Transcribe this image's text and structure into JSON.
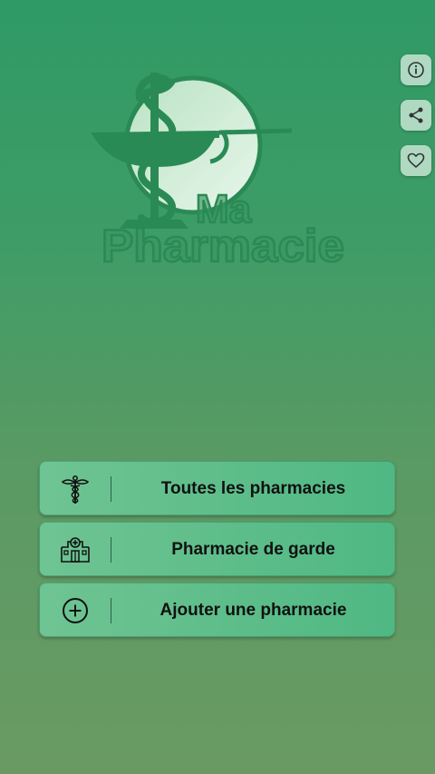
{
  "app": {
    "logo_line1": "Ma",
    "logo_line2": "Pharmacie",
    "logo_icon": "caduceus-bowl-icon"
  },
  "colors": {
    "bg_top": "#2f9a66",
    "bg_bottom": "#6a9a63",
    "button_fill": "#5cbd88",
    "logo_green": "#2a8a55",
    "text": "#111111"
  },
  "side_actions": [
    {
      "icon": "info-icon"
    },
    {
      "icon": "share-icon"
    },
    {
      "icon": "heart-icon"
    }
  ],
  "menu": {
    "all_pharmacies": {
      "label": "Toutes les pharmacies",
      "icon": "caduceus-icon"
    },
    "on_duty": {
      "label": "Pharmacie de garde",
      "icon": "hospital-icon"
    },
    "add_pharmacy": {
      "label": "Ajouter une pharmacie",
      "icon": "plus-circle-icon"
    }
  }
}
